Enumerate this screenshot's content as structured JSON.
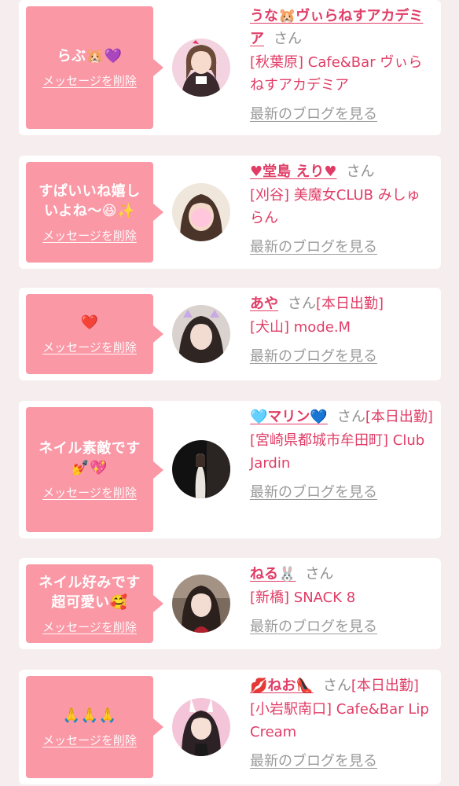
{
  "common": {
    "delete_label": "メッセージを削除",
    "san_label": "さん",
    "blog_label": "最新のブログを見る",
    "accent_color": "#e03d66",
    "bubble_color": "#fa98a6"
  },
  "entries": [
    {
      "message": "らぶ🐹💜",
      "name": "うな🐹ヴぃらねすアカデミア",
      "status": "",
      "shop": "[秋葉原] Cafe&Bar ヴぃらねすアカデミア",
      "avatar_icon": "girl-photo-icon"
    },
    {
      "message": "すぱいいね嬉しいよね〜😆✨",
      "name": "♥堂島 えり♥",
      "status": "",
      "shop": "[刈谷] 美魔女CLUB みしゅらん",
      "avatar_icon": "girl-photo-icon"
    },
    {
      "message": "❤️",
      "name": "あや",
      "status": "[本日出勤]",
      "shop": "[犬山] mode.M",
      "avatar_icon": "girl-photo-icon"
    },
    {
      "message": "ネイル素敵です💅💖",
      "name": "🩵マリン💙",
      "status": "[本日出勤]",
      "shop": "[宮崎県都城市牟田町] Club Jardin",
      "avatar_icon": "girl-photo-icon"
    },
    {
      "message": "ネイル好みです超可愛い🥰",
      "name": "ねる🐰",
      "status": "",
      "shop": "[新橋] SNACK 8",
      "avatar_icon": "girl-photo-icon"
    },
    {
      "message": "🙏🙏🙏",
      "name": "💋ねお👠",
      "status": "[本日出勤]",
      "shop": "[小岩駅南口] Cafe&Bar Lip Cream",
      "avatar_icon": "girl-photo-icon"
    }
  ]
}
